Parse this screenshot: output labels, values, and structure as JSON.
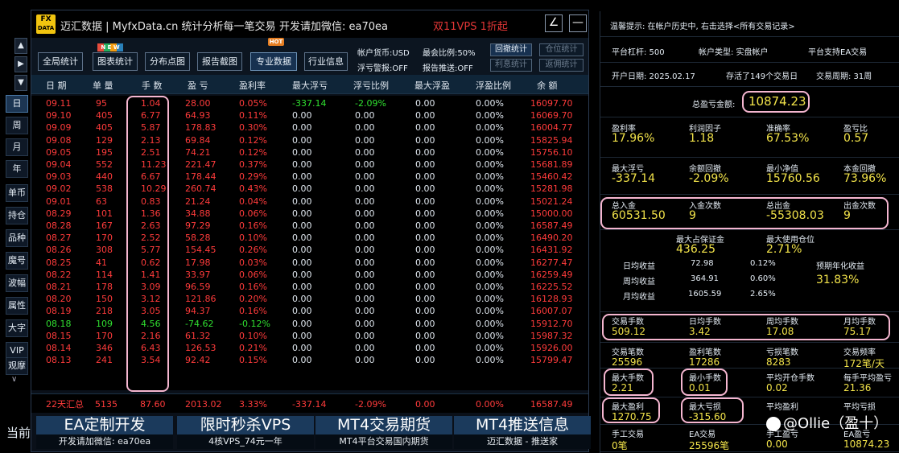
{
  "side": {
    "arrows": [
      "▲",
      "▶",
      "▼"
    ],
    "buttons": [
      "日",
      "周",
      "月",
      "年",
      "单币",
      "持仓",
      "品种",
      "魔号",
      "波幅",
      "属性",
      "大字",
      "VIP",
      "观摩"
    ],
    "bottom_arrow": "∨",
    "bottom_text": "当前"
  },
  "title": {
    "logo_line1": "FX",
    "logo_line2": "DATA",
    "app": "迈汇数据 | MyfxData.cn  统计分析每一笔交易",
    "contact": "开发请加微信: ea70ea",
    "promo": "双11VPS 1折起",
    "btn_edit": "∠",
    "btn_min": "—"
  },
  "toolbar": {
    "badge_new": "N E W",
    "badge_hot": "HOT",
    "buttons": [
      "全局统计",
      "图表统计",
      "分布点图",
      "报告截图",
      "专业数据",
      "行业信息"
    ],
    "currency": "帐户货币:USD",
    "max_ratio": "最会比例:50%",
    "float_warn": "浮亏警报:OFF",
    "report_push": "报告推送:OFF",
    "btn_undo": "回撤统计",
    "btn_position": "仓位统计",
    "btn_profit": "利息统计",
    "btn_rebate": "返佣统计"
  },
  "table": {
    "headers": [
      "日 期",
      "单 量",
      "手 数",
      "盈 亏",
      "盈利率",
      "最大浮亏",
      "浮亏比例",
      "最大浮盈",
      "浮盈比例",
      "余 额"
    ],
    "rows": [
      {
        "date": "09.11",
        "count": "95",
        "lots": "1.04",
        "pnl": "28.00",
        "rate": "0.05%",
        "maxloss": "-337.14",
        "lossratio": "-2.09%",
        "maxgain": "0.00",
        "gainratio": "0.00%",
        "balance": "16097.70",
        "color": "red",
        "lossgreen": true
      },
      {
        "date": "09.10",
        "count": "405",
        "lots": "6.77",
        "pnl": "64.93",
        "rate": "0.11%",
        "maxloss": "0.00",
        "lossratio": "0.00",
        "maxgain": "0.00",
        "gainratio": "0.00%",
        "balance": "16069.70",
        "color": "red"
      },
      {
        "date": "09.09",
        "count": "405",
        "lots": "5.87",
        "pnl": "178.83",
        "rate": "0.30%",
        "maxloss": "0.00",
        "lossratio": "0.00",
        "maxgain": "0.00",
        "gainratio": "0.00%",
        "balance": "16004.77",
        "color": "red"
      },
      {
        "date": "09.08",
        "count": "129",
        "lots": "2.13",
        "pnl": "69.84",
        "rate": "0.12%",
        "maxloss": "0.00",
        "lossratio": "0.00",
        "maxgain": "0.00",
        "gainratio": "0.00%",
        "balance": "15825.94",
        "color": "red"
      },
      {
        "date": "09.05",
        "count": "195",
        "lots": "2.51",
        "pnl": "74.21",
        "rate": "0.12%",
        "maxloss": "0.00",
        "lossratio": "0.00",
        "maxgain": "0.00",
        "gainratio": "0.00%",
        "balance": "15756.10",
        "color": "red"
      },
      {
        "date": "09.04",
        "count": "552",
        "lots": "11.23",
        "pnl": "221.47",
        "rate": "0.37%",
        "maxloss": "0.00",
        "lossratio": "0.00",
        "maxgain": "0.00",
        "gainratio": "0.00%",
        "balance": "15681.89",
        "color": "red"
      },
      {
        "date": "09.03",
        "count": "440",
        "lots": "6.67",
        "pnl": "178.44",
        "rate": "0.29%",
        "maxloss": "0.00",
        "lossratio": "0.00",
        "maxgain": "0.00",
        "gainratio": "0.00%",
        "balance": "15460.42",
        "color": "red"
      },
      {
        "date": "09.02",
        "count": "538",
        "lots": "10.29",
        "pnl": "260.74",
        "rate": "0.43%",
        "maxloss": "0.00",
        "lossratio": "0.00",
        "maxgain": "0.00",
        "gainratio": "0.00%",
        "balance": "15281.98",
        "color": "red"
      },
      {
        "date": "09.01",
        "count": "63",
        "lots": "0.83",
        "pnl": "21.24",
        "rate": "0.04%",
        "maxloss": "0.00",
        "lossratio": "0.00",
        "maxgain": "0.00",
        "gainratio": "0.00%",
        "balance": "15021.24",
        "color": "red"
      },
      {
        "date": "08.29",
        "count": "101",
        "lots": "1.36",
        "pnl": "34.88",
        "rate": "0.06%",
        "maxloss": "0.00",
        "lossratio": "0.00",
        "maxgain": "0.00",
        "gainratio": "0.00%",
        "balance": "15000.00",
        "color": "red"
      },
      {
        "date": "08.28",
        "count": "167",
        "lots": "2.63",
        "pnl": "97.29",
        "rate": "0.16%",
        "maxloss": "0.00",
        "lossratio": "0.00",
        "maxgain": "0.00",
        "gainratio": "0.00%",
        "balance": "16587.49",
        "color": "red"
      },
      {
        "date": "08.27",
        "count": "170",
        "lots": "2.52",
        "pnl": "58.28",
        "rate": "0.10%",
        "maxloss": "0.00",
        "lossratio": "0.00",
        "maxgain": "0.00",
        "gainratio": "0.00%",
        "balance": "16490.20",
        "color": "red"
      },
      {
        "date": "08.26",
        "count": "308",
        "lots": "5.77",
        "pnl": "154.45",
        "rate": "0.26%",
        "maxloss": "0.00",
        "lossratio": "0.00",
        "maxgain": "0.00",
        "gainratio": "0.00%",
        "balance": "16431.92",
        "color": "red"
      },
      {
        "date": "08.25",
        "count": "41",
        "lots": "0.62",
        "pnl": "17.98",
        "rate": "0.03%",
        "maxloss": "0.00",
        "lossratio": "0.00",
        "maxgain": "0.00",
        "gainratio": "0.00%",
        "balance": "16277.47",
        "color": "red"
      },
      {
        "date": "08.22",
        "count": "114",
        "lots": "1.41",
        "pnl": "33.97",
        "rate": "0.06%",
        "maxloss": "0.00",
        "lossratio": "0.00",
        "maxgain": "0.00",
        "gainratio": "0.00%",
        "balance": "16259.49",
        "color": "red"
      },
      {
        "date": "08.21",
        "count": "178",
        "lots": "3.09",
        "pnl": "96.59",
        "rate": "0.16%",
        "maxloss": "0.00",
        "lossratio": "0.00",
        "maxgain": "0.00",
        "gainratio": "0.00%",
        "balance": "16225.52",
        "color": "red"
      },
      {
        "date": "08.20",
        "count": "150",
        "lots": "3.12",
        "pnl": "121.86",
        "rate": "0.20%",
        "maxloss": "0.00",
        "lossratio": "0.00",
        "maxgain": "0.00",
        "gainratio": "0.00%",
        "balance": "16128.93",
        "color": "red"
      },
      {
        "date": "08.19",
        "count": "218",
        "lots": "3.05",
        "pnl": "94.37",
        "rate": "0.16%",
        "maxloss": "0.00",
        "lossratio": "0.00",
        "maxgain": "0.00",
        "gainratio": "0.00%",
        "balance": "16007.07",
        "color": "red"
      },
      {
        "date": "08.18",
        "count": "109",
        "lots": "4.56",
        "pnl": "-74.62",
        "rate": "-0.12%",
        "maxloss": "0.00",
        "lossratio": "0.00",
        "maxgain": "0.00",
        "gainratio": "0.00%",
        "balance": "15912.70",
        "color": "green"
      },
      {
        "date": "08.15",
        "count": "170",
        "lots": "2.16",
        "pnl": "61.32",
        "rate": "0.10%",
        "maxloss": "0.00",
        "lossratio": "0.00",
        "maxgain": "0.00",
        "gainratio": "0.00%",
        "balance": "15987.32",
        "color": "red"
      },
      {
        "date": "08.14",
        "count": "346",
        "lots": "6.43",
        "pnl": "126.53",
        "rate": "0.21%",
        "maxloss": "0.00",
        "lossratio": "0.00",
        "maxgain": "0.00",
        "gainratio": "0.00%",
        "balance": "15926.00",
        "color": "red"
      },
      {
        "date": "08.13",
        "count": "241",
        "lots": "3.54",
        "pnl": "92.42",
        "rate": "0.15%",
        "maxloss": "0.00",
        "lossratio": "0.00",
        "maxgain": "0.00",
        "gainratio": "0.00%",
        "balance": "15799.47",
        "color": "red"
      }
    ],
    "summary": {
      "date": "22天汇总",
      "count": "5135",
      "lots": "87.60",
      "pnl": "2013.02",
      "rate": "3.33%",
      "maxloss": "-337.14",
      "lossratio": "-2.09%",
      "maxgain": "0.00",
      "gainratio": "0.00%",
      "balance": "16587.49"
    }
  },
  "ads": [
    {
      "top": "EA定制开发",
      "bottom": "开发请加微信: ea70ea"
    },
    {
      "top": "限时秒杀VPS",
      "bottom": "4核VPS_74元一年"
    },
    {
      "top": "MT4交易期货",
      "bottom": "MT4平台交易国内期货"
    },
    {
      "top": "MT4推送信息",
      "bottom": "迈汇数据 - 推送家"
    }
  ],
  "right": {
    "tip": "温馨提示: 在帐户历史中, 右击选择<所有交易记录>",
    "leverage": "平台杠杆: 500",
    "acct_type": "帐户类型: 实盘帐户",
    "ea_support": "平台支持EA交易",
    "open_date": "开户日期: 2025.02.17",
    "survive": "存活了149个交易日",
    "trade_period": "交易周期: 31周",
    "total_profit_label": "总盈亏金额:",
    "total_profit": "10874.23",
    "g1": [
      {
        "label": "盈利率",
        "value": "17.96%"
      },
      {
        "label": "利润因子",
        "value": "1.18"
      },
      {
        "label": "准确率",
        "value": "67.53%"
      },
      {
        "label": "盈亏比",
        "value": "0.57"
      }
    ],
    "g2": [
      {
        "label": "最大浮亏",
        "value": "-337.14"
      },
      {
        "label": "余额回撤",
        "value": "-2.09%"
      },
      {
        "label": "最小净值",
        "value": "15760.56"
      },
      {
        "label": "本金回撤",
        "value": "73.96%"
      }
    ],
    "g3": [
      {
        "label": "总入金",
        "value": "60531.50"
      },
      {
        "label": "入金次数",
        "value": "9"
      },
      {
        "label": "总出金",
        "value": "-55308.03"
      },
      {
        "label": "出金次数",
        "value": "9"
      }
    ],
    "g4": [
      {
        "label": "最大占保证金",
        "value": "436.25"
      },
      {
        "label": "最大使用仓位",
        "value": "2.71%"
      }
    ],
    "avg": [
      {
        "label": "日均收益",
        "amount": "72.98",
        "pct": "0.12%"
      },
      {
        "label": "周均收益",
        "amount": "364.91",
        "pct": "0.60%"
      },
      {
        "label": "月均收益",
        "amount": "1605.59",
        "pct": "2.65%"
      }
    ],
    "annual_label": "预期年化收益",
    "annual_value": "31.83%",
    "g5": [
      {
        "label": "交易手数",
        "value": "509.12"
      },
      {
        "label": "日均手数",
        "value": "3.42"
      },
      {
        "label": "周均手数",
        "value": "17.08"
      },
      {
        "label": "月均手数",
        "value": "75.17"
      }
    ],
    "g6": [
      {
        "label": "交易笔数",
        "value": "25596"
      },
      {
        "label": "盈利笔数",
        "value": "17286"
      },
      {
        "label": "亏损笔数",
        "value": "8283"
      },
      {
        "label": "交易频率",
        "value": "172笔/天"
      }
    ],
    "g7": [
      {
        "label": "最大手数",
        "value": "2.21"
      },
      {
        "label": "最小手数",
        "value": "0.01"
      },
      {
        "label": "平均开仓手数",
        "value": "0.02"
      },
      {
        "label": "每手平均盈亏",
        "value": "21.36"
      }
    ],
    "g8": [
      {
        "label": "最大盈利",
        "value": "1270.75"
      },
      {
        "label": "最大亏损",
        "value": "-315.60"
      },
      {
        "label": "平均盈利",
        "value": ""
      },
      {
        "label": "平均亏损",
        "value": ""
      }
    ],
    "g9": [
      {
        "label": "手工交易",
        "value": "0笔"
      },
      {
        "label": "EA交易",
        "value": "25596笔"
      },
      {
        "label": "手工盈亏",
        "value": "0.00"
      },
      {
        "label": "EA盈亏",
        "value": "10874.23"
      }
    ],
    "watermark": "@Ollie（盈十）"
  }
}
